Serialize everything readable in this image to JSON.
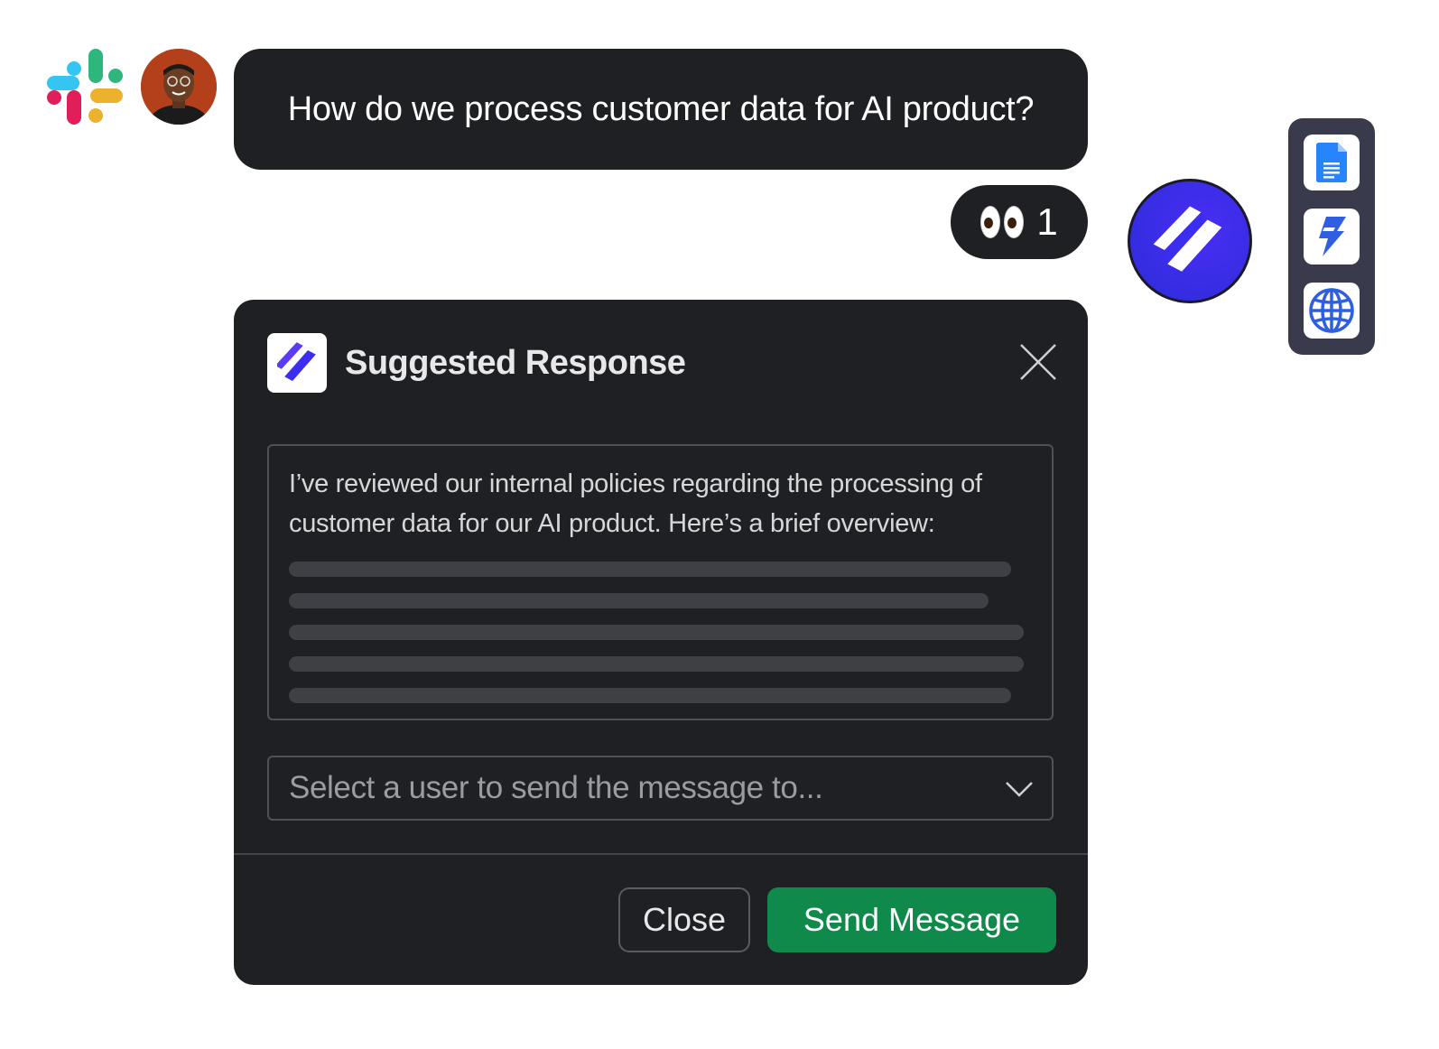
{
  "message": {
    "question": "How do we process customer data for AI product?"
  },
  "reaction": {
    "emoji": "eyes-emoji",
    "count": "1"
  },
  "side_toolbar": {
    "icons": [
      "google-docs-icon",
      "lightning-app-icon",
      "globe-icon"
    ]
  },
  "card": {
    "title": "Suggested Response",
    "response_text": "I’ve reviewed our internal policies regarding the processing of customer data for our AI product. Here’s a brief overview:",
    "select_placeholder": "Select a user to send the message to...",
    "close_label": "Close",
    "send_label": "Send Message"
  },
  "colors": {
    "card_bg": "#1f2023",
    "send_button": "#0f8a4a",
    "bot_accent": "#3b2ef0",
    "toolbar_bg": "#3a3a4d"
  }
}
